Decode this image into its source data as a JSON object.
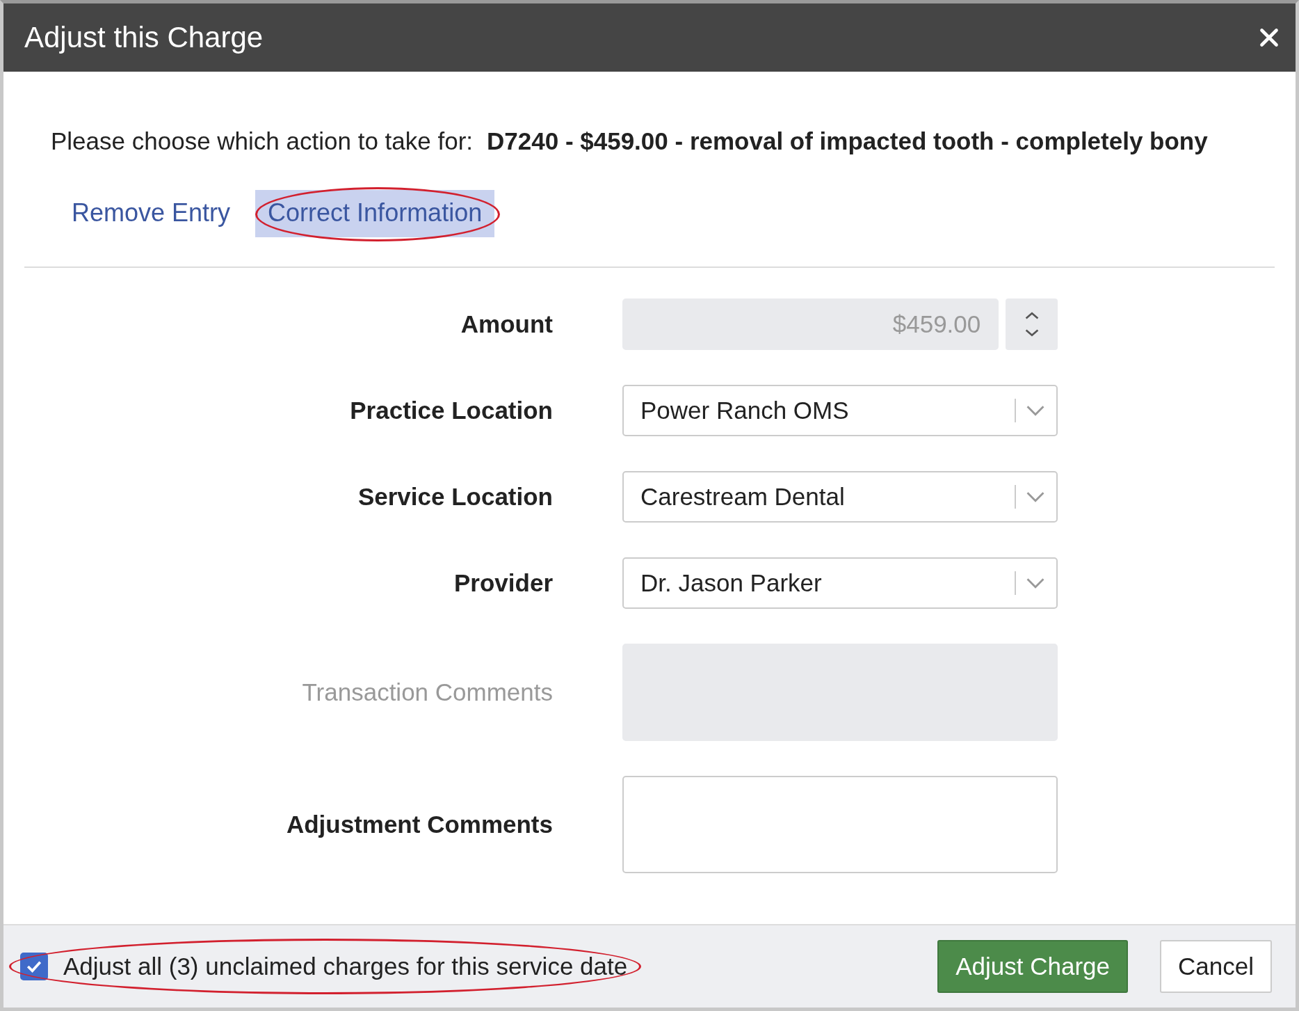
{
  "dialog": {
    "title": "Adjust this Charge"
  },
  "prompt": {
    "label": "Please choose which action to take for:",
    "charge": "D7240 - $459.00 - removal of impacted tooth - completely bony"
  },
  "tabs": [
    {
      "label": "Remove Entry",
      "selected": false,
      "circled": false
    },
    {
      "label": "Correct Information",
      "selected": true,
      "circled": true
    }
  ],
  "fields": [
    {
      "kind": "number",
      "label": "Amount",
      "value": "$459.00",
      "disabled": true
    },
    {
      "kind": "select",
      "label": "Practice Location",
      "value": "Power Ranch OMS",
      "disabled": false
    },
    {
      "kind": "select",
      "label": "Service Location",
      "value": "Carestream Dental",
      "disabled": false
    },
    {
      "kind": "select",
      "label": "Provider",
      "value": "Dr. Jason Parker",
      "disabled": false
    },
    {
      "kind": "textarea",
      "label": "Transaction Comments",
      "disabled": true
    },
    {
      "kind": "textarea",
      "label": "Adjustment Comments",
      "disabled": false
    }
  ],
  "footer": {
    "checkbox": {
      "label": "Adjust all (3) unclaimed charges for this service date",
      "checked": true,
      "circled": true
    },
    "buttons": [
      {
        "label": "Adjust Charge",
        "kind": "primary"
      },
      {
        "label": "Cancel",
        "kind": "secondary"
      }
    ]
  }
}
